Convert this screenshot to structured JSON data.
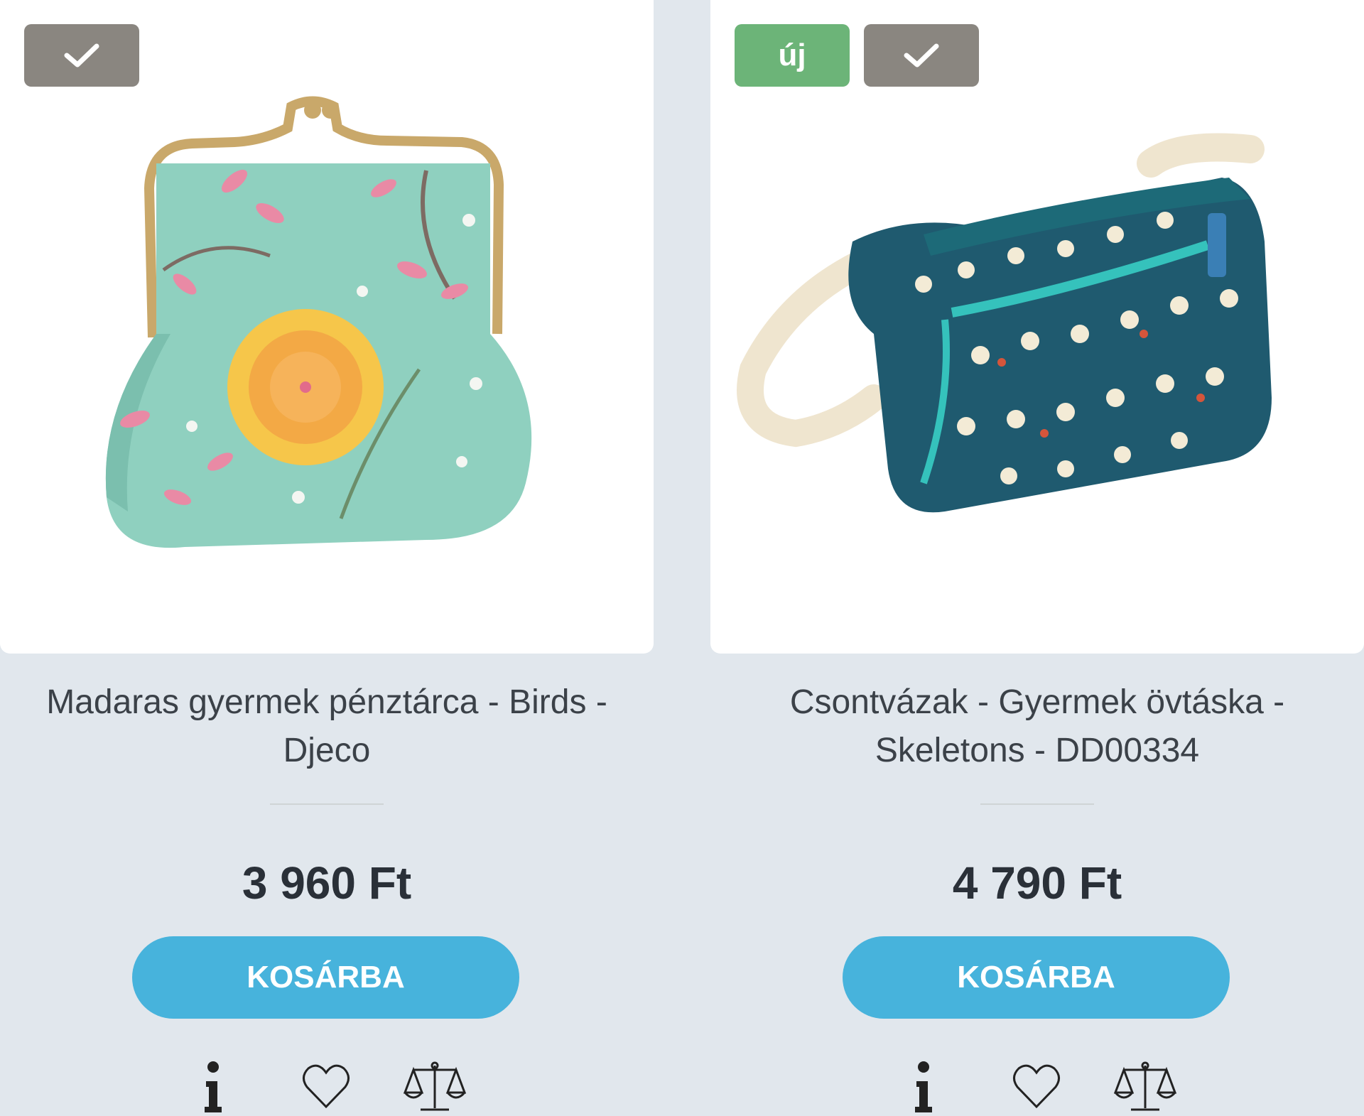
{
  "products": [
    {
      "badges": [
        "check"
      ],
      "title_line1": "Madaras gyermek pénztárca - Birds -",
      "title_line2": "Djeco",
      "price": "3 960 Ft",
      "cart_label": "KOSÁRBA",
      "image_icon": "coin-purse-image"
    },
    {
      "badges": [
        "new",
        "check"
      ],
      "new_label": "új",
      "title_line1": "Csontvázak - Gyermek övtáska -",
      "title_line2": "Skeletons - DD00334",
      "price": "4 790 Ft",
      "cart_label": "KOSÁRBA",
      "image_icon": "belt-bag-image"
    }
  ],
  "icons": [
    "info-icon",
    "heart-icon",
    "compare-scale-icon",
    "check-icon"
  ],
  "colors": {
    "background": "#e1e7ed",
    "check_badge": "#8a8680",
    "new_badge": "#6cb478",
    "cart_button": "#47b3dc",
    "text": "#3b4148"
  }
}
